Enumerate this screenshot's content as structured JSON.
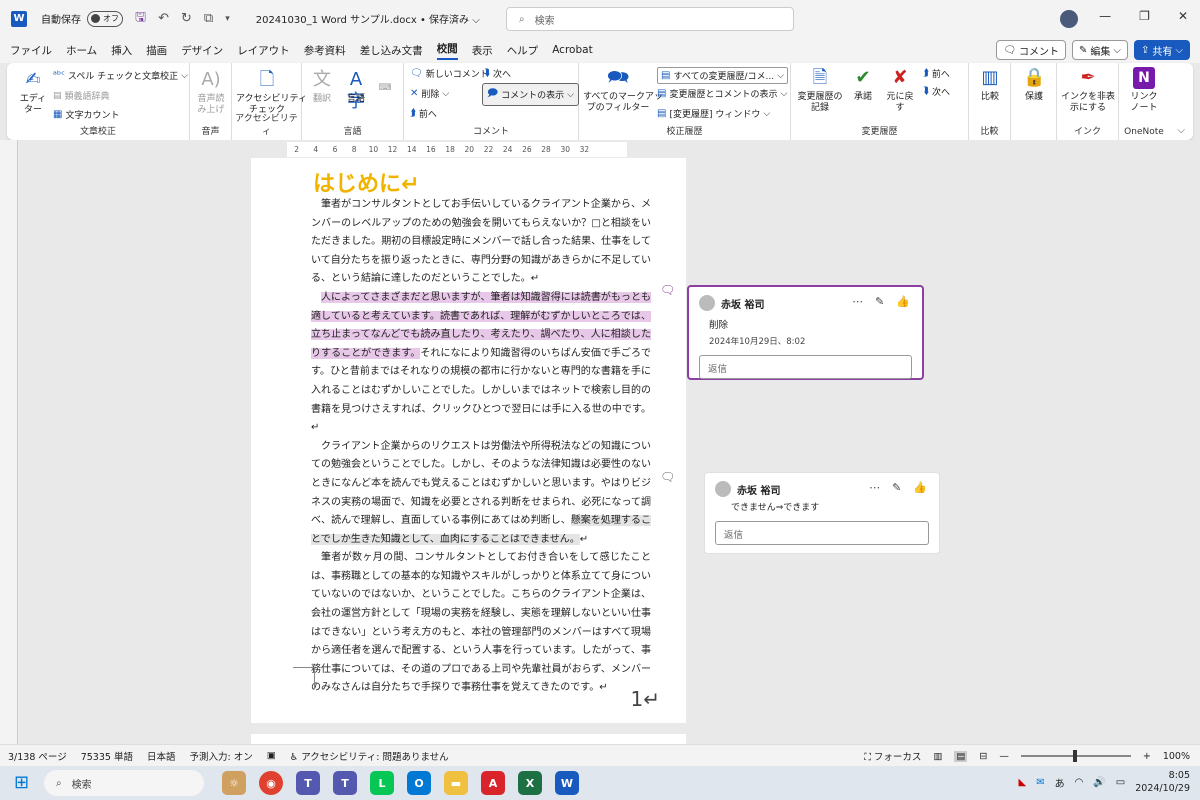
{
  "titlebar": {
    "autosave_label": "自動保存",
    "toggle_label": "オフ",
    "doc_title": "20241030_1 Word サンプル.docx • 保存済み ⌵",
    "search_placeholder": "検索"
  },
  "menu": {
    "tabs": [
      "ファイル",
      "ホーム",
      "挿入",
      "描画",
      "デザイン",
      "レイアウト",
      "参考資料",
      "差し込み文書",
      "校閲",
      "表示",
      "ヘルプ",
      "Acrobat"
    ],
    "active": "校閲",
    "comment_btn": "コメント",
    "edit_btn": "編集",
    "share_btn": "共有"
  },
  "ribbon": {
    "editor": "エディ\nター",
    "spell": "スペル チェックと文章校正",
    "thesaurus": "類義語辞典",
    "wordcount": "文字カウント",
    "group_proofing": "文章校正",
    "read_aloud": "音声読\nみ上げ",
    "group_voice": "音声",
    "accessibility_check": "アクセシビリティ\nチェック",
    "group_accessibility": "アクセシビリティ",
    "translate": "翻訳",
    "language": "言語",
    "group_language": "言語",
    "new_comment": "新しいコメント",
    "delete": "削除",
    "prev": "前へ",
    "next": "次へ",
    "show_comments": "コメントの表示",
    "group_comments": "コメント",
    "all_markup": "すべてのマークアッ\nプのフィルター",
    "track_dropdown": "すべての変更履歴/コメ...",
    "show_markup": "変更履歴とコメントの表示",
    "reviewing_pane": "[変更履歴] ウィンドウ",
    "group_tracking": "校正履歴",
    "track_changes": "変更履歴の\n記録",
    "accept": "承諾",
    "reject": "元に戻\nす",
    "prev2": "前へ",
    "next2": "次へ",
    "group_changes": "変更履歴",
    "compare": "比較",
    "group_compare": "比較",
    "protect": "保護",
    "hide_ink": "インクを非表\n示にする",
    "group_ink": "インク",
    "linked_notes": "リンク\nノート",
    "group_onenote": "OneNote"
  },
  "ruler_ticks": [
    "2",
    "4",
    "6",
    "8",
    "10",
    "12",
    "14",
    "16",
    "18",
    "20",
    "22",
    "24",
    "26",
    "28",
    "30",
    "32"
  ],
  "document": {
    "heading": "はじめに↵",
    "p1": "筆者がコンサルタントとしてお手伝いしているクライアント企業から、メンバーのレベルアップのための勉強会を開いてもらえないか？□と相談をいただきました。期初の目標設定時にメンバーで話し合った結果、仕事をしていて自分たちを振り返ったときに、専門分野の知識があきらかに不足している、という結論に達したのだということでした。↵",
    "p2_highlight": "人によってさまざまだと思いますが、筆者は知識習得には読書がもっとも適していると考えています。読書であれば、理解がむずかしいところでは、立ち止まってなんどでも読み直したり、考えたり、調べたり、人に相談したりすることができます。",
    "p2_rest": "それになにより知識習得のいちばん安価で手ごろです。ひと昔前まではそれなりの規模の都市に行かないと専門的な書籍を手に入れることはむずかしいことでした。しかしいまではネットで検索し目的の書籍を見つけさえすれば、クリックひとつで翌日には手に入る世の中です。↵",
    "p3_start": "クライアント企業からのリクエストは労働法や所得税法などの知識についての勉強会ということでした。しかし、そのような法律知識は必要性のないときになんど本を読んでも覚えることはむずかしいと思います。やはりビジネスの実務の場面で、知識を必要とされる判断をせまられ、必死になって調べ、読んで理解し、直面している事例にあてはめ判断し、",
    "p3_highlight": "懸案を処理することでしか生きた知識として、血肉にすることはできません。",
    "p3_end": "↵",
    "p4": "筆者が数ヶ月の間、コンサルタントとしてお付き合いをして感じたことは、事務職としての基本的な知識やスキルがしっかりと体系立てて身についていないのではないか、ということでした。こちらのクライアント企業は、会社の運営方針として「現場の実務を経験し、実態を理解しないといい仕事はできない」という考え方のもと、本社の管理部門のメンバーはすべて現場から適任者を選んで配置する、という人事を行っています。したがって、事務仕事については、その道のプロである上司や先輩社員がおらず、メンバーのみなさんは自分たちで手探りで事務仕事を覚えてきたのです。↵",
    "page_number": "1↵"
  },
  "comments": [
    {
      "author": "赤坂 裕司",
      "text": "削除",
      "time": "2024年10月29日、8:02",
      "reply": "返信"
    },
    {
      "author": "赤坂 裕司",
      "text": "できません⇒できます",
      "reply": "返信"
    }
  ],
  "status": {
    "page": "3/138 ページ",
    "words": "75335 単語",
    "lang": "日本語",
    "predict": "予測入力: オン",
    "accessibility": "アクセシビリティ: 問題ありません",
    "focus": "フォーカス",
    "zoom": "100%"
  },
  "taskbar": {
    "search": "検索",
    "ime": "あ",
    "time": "8:05",
    "date": "2024/10/29"
  }
}
